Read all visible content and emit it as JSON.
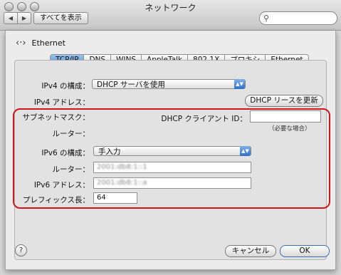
{
  "window": {
    "title": "ネットワーク"
  },
  "toolbar": {
    "back_icon": "◀",
    "forward_icon": "▶",
    "show_all_label": "すべてを表示",
    "search_placeholder": ""
  },
  "service": {
    "name": "Ethernet"
  },
  "tabs": [
    "TCP/IP",
    "DNS",
    "WINS",
    "AppleTalk",
    "802.1X",
    "プロキシ",
    "Ethernet"
  ],
  "ipv4": {
    "configure_label": "IPv4 の構成：",
    "configure_value": "DHCP サーバを使用",
    "address_label": "IPv4 アドレス：",
    "subnet_label": "サブネットマスク：",
    "router_label": "ルーター：",
    "renew_button": "DHCP リースを更新",
    "client_id_label": "DHCP クライアント ID：",
    "client_id_value": "",
    "client_id_note": "（必要な場合）"
  },
  "ipv6": {
    "configure_label": "IPv6 の構成：",
    "configure_value": "手入力",
    "router_label": "ルーター：",
    "router_value": "2001:db8:1::1",
    "address_label": "IPv6 アドレス：",
    "address_value": "2001:db8:1::a",
    "prefix_label": "プレフィックス長：",
    "prefix_value": "64"
  },
  "footer": {
    "help_label": "?",
    "cancel_label": "キャンセル",
    "ok_label": "OK"
  },
  "colors": {
    "tab_active": "#5b9be0",
    "highlight": "#d0161a",
    "popup_arrow": "#2e6fc8"
  }
}
